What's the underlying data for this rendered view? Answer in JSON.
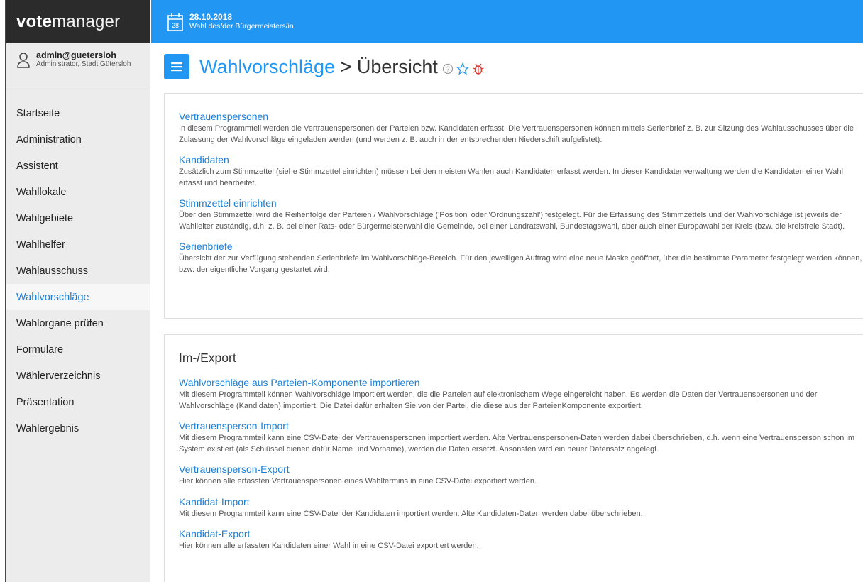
{
  "brand": {
    "bold": "vote",
    "rest": "manager"
  },
  "user": {
    "name": "admin@guetersloh",
    "role": "Administrator, Stadt Gütersloh"
  },
  "header": {
    "date": "28.10.2018",
    "election": "Wahl des/der Bürgermeisters/in",
    "calendar_day": "28"
  },
  "nav": [
    {
      "label": "Startseite"
    },
    {
      "label": "Administration"
    },
    {
      "label": "Assistent"
    },
    {
      "label": "Wahllokale"
    },
    {
      "label": "Wahlgebiete"
    },
    {
      "label": "Wahlhelfer"
    },
    {
      "label": "Wahlausschuss"
    },
    {
      "label": "Wahlvorschläge"
    },
    {
      "label": "Wahlorgane prüfen"
    },
    {
      "label": "Formulare"
    },
    {
      "label": "Wählerverzeichnis"
    },
    {
      "label": "Präsentation"
    },
    {
      "label": "Wahlergebnis"
    }
  ],
  "page": {
    "title_link": "Wahlvorschläge",
    "title_rest": " > Übersicht"
  },
  "colors": {
    "accent": "#2196f3",
    "sidebar_dark": "#2b2b2b",
    "bug": "#e53935"
  },
  "icons": {
    "menu": "hamburger-icon",
    "help": "help-circle-icon",
    "favorite": "star-outline-icon",
    "bug": "bug-icon",
    "user": "user-icon",
    "calendar": "calendar-icon"
  },
  "section1": {
    "entries": [
      {
        "title": "Vertrauenspersonen",
        "desc": "In diesem Programmteil werden die Vertrauenspersonen der Parteien bzw. Kandidaten erfasst. Die Vertrauenspersonen können mittels Serienbrief z. B. zur Sitzung des Wahlausschusses über die Zulassung der Wahlvorschläge eingeladen werden (und werden z. B. auch in der entsprechenden Niederschift aufgelistet)."
      },
      {
        "title": "Kandidaten",
        "desc": "Zusätzlich zum Stimmzettel (siehe Stimmzettel einrichten) müssen bei den meisten Wahlen auch Kandidaten erfasst werden. In dieser Kandidatenverwaltung werden die Kandidaten einer Wahl erfasst und bearbeitet."
      },
      {
        "title": "Stimmzettel einrichten",
        "desc": "Über den Stimmzettel wird die Reihenfolge der Parteien / Wahlvorschläge ('Position' oder 'Ordnungszahl') festgelegt. Für die Erfassung des Stimmzettels und der Wahlvorschläge ist jeweils der Wahlleiter zuständig, d.h. z. B. bei einer Rats- oder Bürgermeisterwahl die Gemeinde, bei einer Landratswahl, Bundestagswahl, aber auch einer Europawahl der Kreis (bzw. die kreisfreie Stadt)."
      },
      {
        "title": "Serienbriefe",
        "desc": "Übersicht der zur Verfügung stehenden Serienbriefe im Wahlvorschläge-Bereich. Für den jeweiligen Auftrag wird eine neue Maske geöffnet, über die bestimmte Parameter festgelegt werden können, bzw. der eigentliche Vorgang gestartet wird."
      }
    ]
  },
  "section2": {
    "heading": "Im-/Export",
    "entries": [
      {
        "title": "Wahlvorschläge aus Parteien-Komponente importieren",
        "desc": "Mit diesem Programmteil können Wahlvorschläge importiert werden, die die Parteien auf elektronischem Wege eingereicht haben. Es werden die Daten der Vertrauenspersonen und der Wahlvorschläge (Kandidaten) importiert. Die Datei dafür erhalten Sie von der Partei, die diese aus der ParteienKomponente exportiert."
      },
      {
        "title": "Vertrauensperson-Import",
        "desc": "Mit diesem Programmteil kann eine CSV-Datei der Vertrauenspersonen importiert werden. Alte Vertrauenspersonen-Daten werden dabei überschrieben, d.h. wenn eine Vertrauensperson schon im System existiert (als Schlüssel dienen dafür Name und Vorname), werden die Daten ersetzt. Ansonsten wird ein neuer Datensatz angelegt."
      },
      {
        "title": "Vertrauensperson-Export",
        "desc": "Hier können alle erfassten Vertrauenspersonen eines Wahltermins in eine CSV-Datei exportiert werden."
      },
      {
        "title": "Kandidat-Import",
        "desc": "Mit diesem Programmteil kann eine CSV-Datei der Kandidaten importiert werden. Alte Kandidaten-Daten werden dabei überschrieben."
      },
      {
        "title": "Kandidat-Export",
        "desc": "Hier können alle erfassten Kandidaten einer Wahl in eine CSV-Datei exportiert werden."
      }
    ]
  }
}
